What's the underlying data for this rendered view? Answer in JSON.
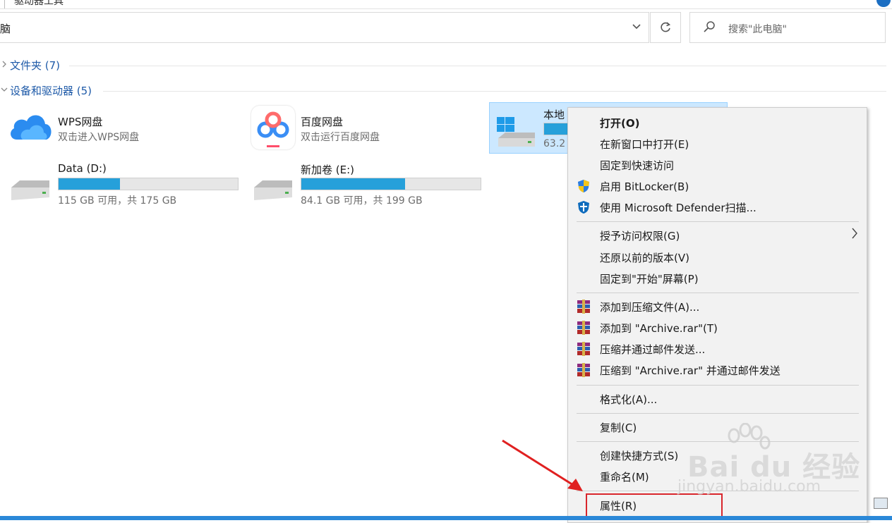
{
  "ribbon": {
    "tab_text": "驱动器工具"
  },
  "address": {
    "path": "脑",
    "search_placeholder": "搜索\"此电脑\""
  },
  "groups": {
    "folders": {
      "label": "文件夹 (7)",
      "chevron": ">"
    },
    "devices": {
      "label": "设备和驱动器 (5)",
      "chevron": "v"
    }
  },
  "items": {
    "wps": {
      "name": "WPS网盘",
      "sub": "双击进入WPS网盘"
    },
    "baidu": {
      "name": "百度网盘",
      "sub": "双击运行百度网盘"
    },
    "local_c": {
      "name": "本地",
      "sub": "63.2",
      "used_fraction": 0.45
    },
    "data_d": {
      "name": "Data (D:)",
      "sub": "115 GB 可用，共 175 GB",
      "used_fraction": 0.343
    },
    "new_e": {
      "name": "新加卷 (E:)",
      "sub": "84.1 GB 可用，共 199 GB",
      "used_fraction": 0.577
    }
  },
  "context_menu": {
    "open": "打开(O)",
    "open_new_window": "在新窗口中打开(E)",
    "pin_quick_access": "固定到快速访问",
    "bitlocker": "启用 BitLocker(B)",
    "defender": "使用 Microsoft Defender扫描...",
    "grant_access": "授予访问权限(G)",
    "restore_versions": "还原以前的版本(V)",
    "pin_start": "固定到\"开始\"屏幕(P)",
    "add_archive": "添加到压缩文件(A)...",
    "add_rar": "添加到 \"Archive.rar\"(T)",
    "compress_email": "压缩并通过邮件发送...",
    "compress_rar_email": "压缩到 \"Archive.rar\" 并通过邮件发送",
    "format": "格式化(A)...",
    "copy": "复制(C)",
    "create_shortcut": "创建快捷方式(S)",
    "rename": "重命名(M)",
    "properties": "属性(R)"
  },
  "watermark": {
    "brand": "Bai du 经验",
    "url": "jingyan.baidu.com"
  },
  "colors": {
    "accent": "#26a0da",
    "selection": "#cce8ff",
    "highlight": "#d9262c"
  }
}
